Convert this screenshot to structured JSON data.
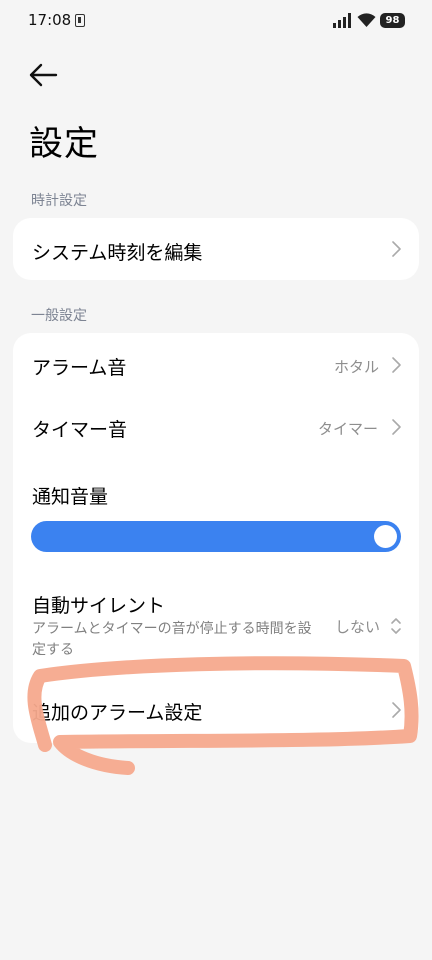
{
  "status_bar": {
    "time": "17:08",
    "battery": "98",
    "icons": [
      "sim-icon",
      "signal-icon",
      "wifi-icon",
      "battery-icon"
    ]
  },
  "header": {
    "back_icon": "arrow-left-icon",
    "title": "設定"
  },
  "sections": {
    "clock": {
      "label": "時計設定",
      "items": [
        {
          "title": "システム時刻を編集",
          "icon": "chevron-right-icon"
        }
      ]
    },
    "general": {
      "label": "一般設定",
      "alarm_sound": {
        "title": "アラーム音",
        "value": "ホタル",
        "icon": "chevron-right-icon"
      },
      "timer_sound": {
        "title": "タイマー音",
        "value": "タイマー",
        "icon": "chevron-right-icon"
      },
      "notification_volume": {
        "title": "通知音量",
        "level": 1.0
      },
      "auto_silent": {
        "title": "自動サイレント",
        "subtitle": "アラームとタイマーの音が停止する時間を設定する",
        "value": "しない",
        "icon": "chevron-up-down-icon"
      },
      "additional_alarm": {
        "title": "追加のアラーム設定",
        "icon": "chevron-right-icon"
      }
    }
  },
  "colors": {
    "background": "#f5f5f5",
    "card": "#ffffff",
    "accent": "#3b82f0",
    "section_label": "#7d8493",
    "annotation": "#f6a98d"
  }
}
